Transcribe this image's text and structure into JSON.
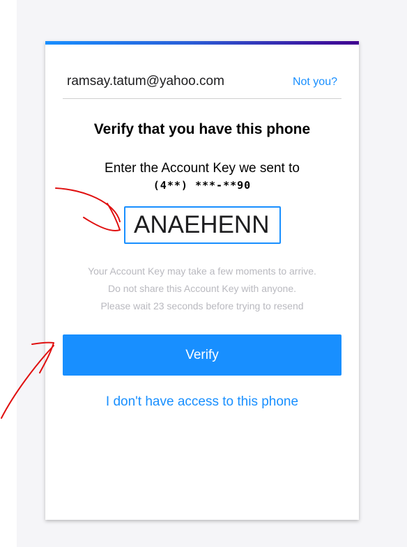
{
  "account": {
    "email": "ramsay.tatum@yahoo.com",
    "not_you_label": "Not you?"
  },
  "verify": {
    "title": "Verify that you have this phone",
    "instruction": "Enter the Account Key we sent to",
    "masked_phone": "(4**) ***-**90",
    "key_value": "ANAEHENN",
    "hints": [
      "Your Account Key may take a few moments to arrive.",
      "Do not share this Account Key with anyone.",
      "Please wait 23 seconds before trying to resend"
    ],
    "verify_button_label": "Verify",
    "no_access_link": "I don't have access to this phone"
  },
  "colors": {
    "accent": "#188fff",
    "annotation": "#e01010",
    "hint_text": "#b9b9bf",
    "backdrop": "#f5f5f8"
  }
}
